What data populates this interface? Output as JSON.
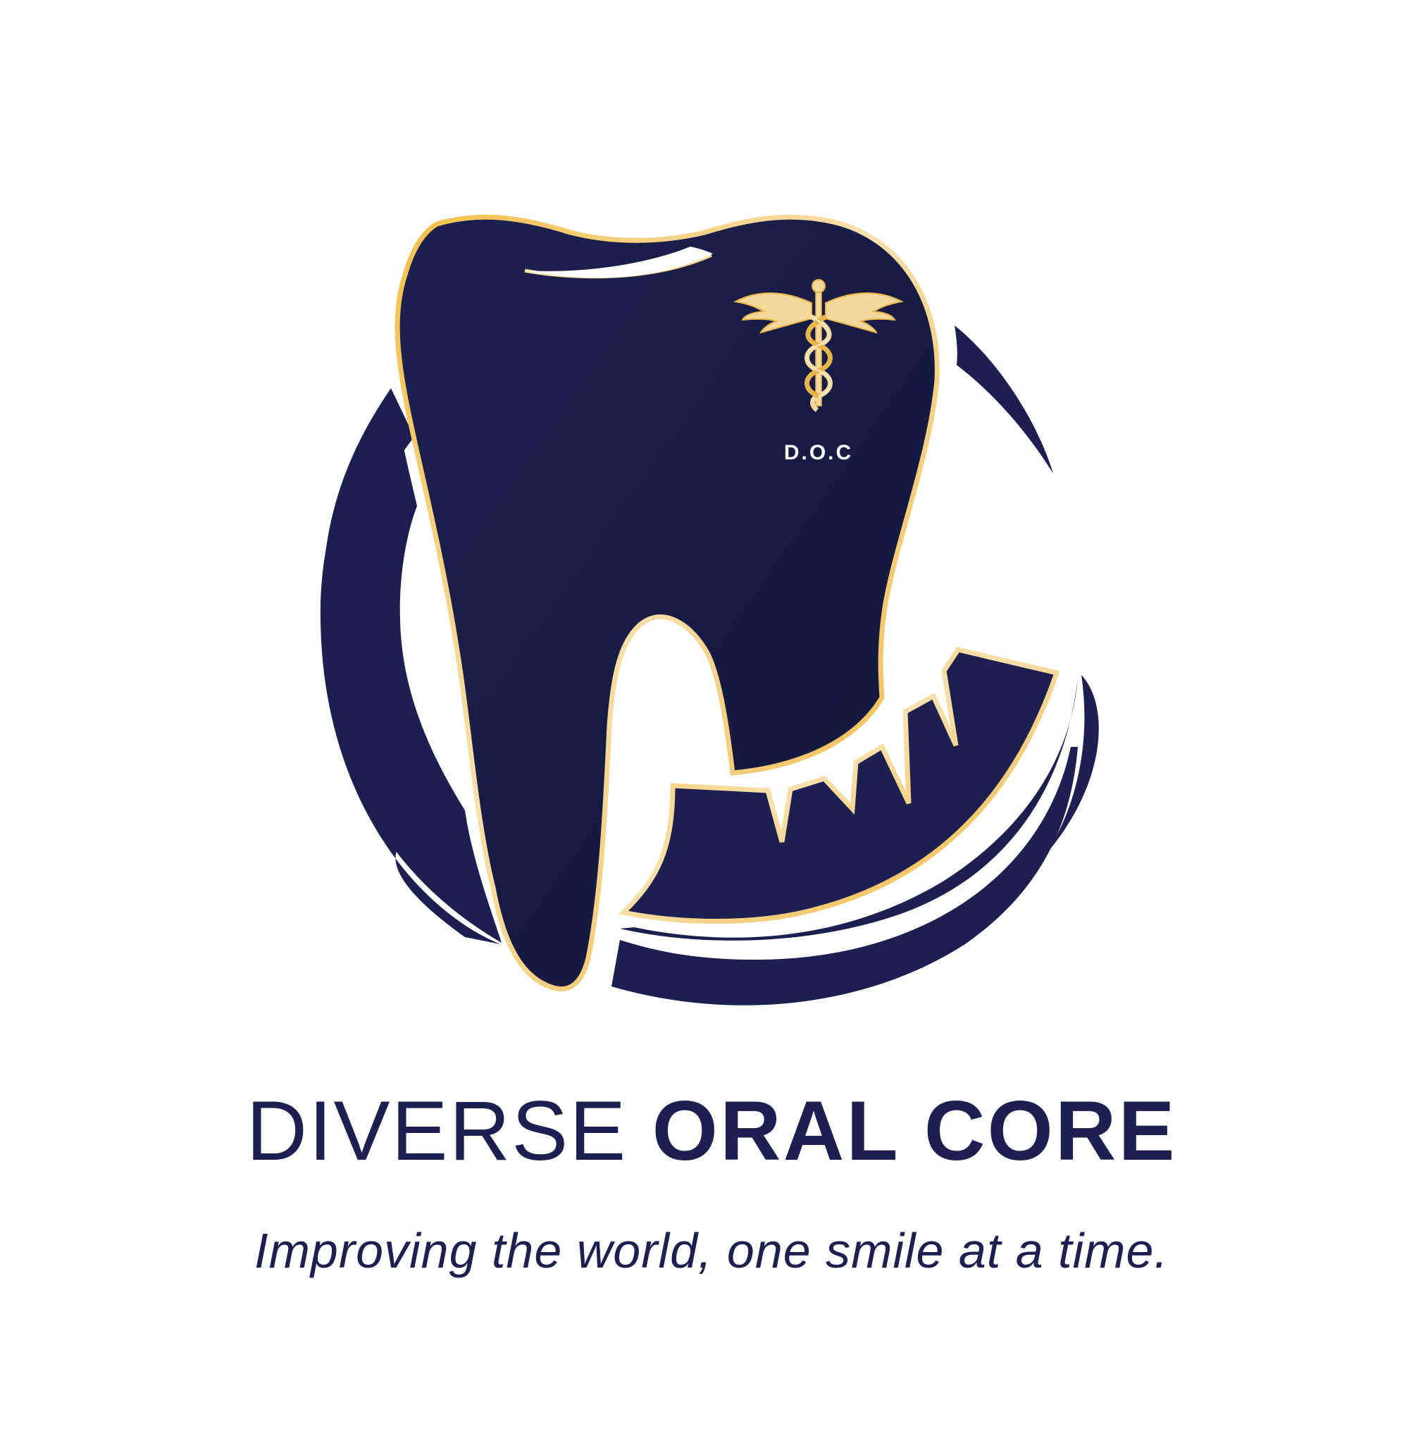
{
  "brand": {
    "name_light": "DIVERSE",
    "name_bold": "ORAL CORE",
    "tagline": "Improving the world, one smile at a time.",
    "emblem_text": "D.O.C"
  },
  "icons": {
    "tooth": "tooth-icon",
    "caduceus": "caduceus-icon",
    "swoosh": "circular-swoosh-icon"
  },
  "colors": {
    "navy": "#1c1f4f",
    "navy_dark": "#141842",
    "gold": "#f2b938",
    "gold_light": "#f6dca8",
    "background": "#ffffff"
  }
}
